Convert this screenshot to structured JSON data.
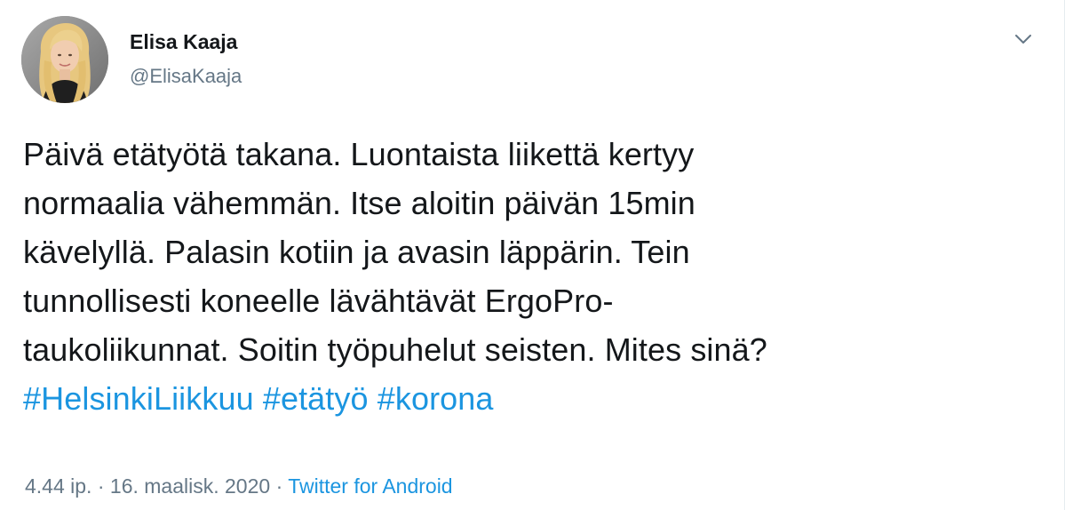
{
  "author": {
    "name": "Elisa Kaaja",
    "handle": "@ElisaKaaja"
  },
  "tweet": {
    "lines": [
      "Päivä etätyötä takana. Luontaista liikettä kertyy",
      "normaalia vähemmän. Itse aloitin päivän 15min",
      "kävelyllä. Palasin kotiin ja avasin läppärin. Tein",
      "tunnollisesti koneelle lävähtävät ErgoPro-",
      "taukoliikunnat. Soitin työpuhelut seisten. Mites sinä?"
    ],
    "hashtags": [
      "#HelsinkiLiikkuu",
      "#etätyö",
      "#korona"
    ]
  },
  "meta": {
    "time": "4.44 ip.",
    "separator": "·",
    "date": "16. maalisk. 2020",
    "source": "Twitter for Android"
  },
  "colors": {
    "link": "#1b95e0",
    "secondary_text": "#657786",
    "primary_text": "#14171a"
  },
  "icons": {
    "menu": "chevron-down-icon"
  }
}
